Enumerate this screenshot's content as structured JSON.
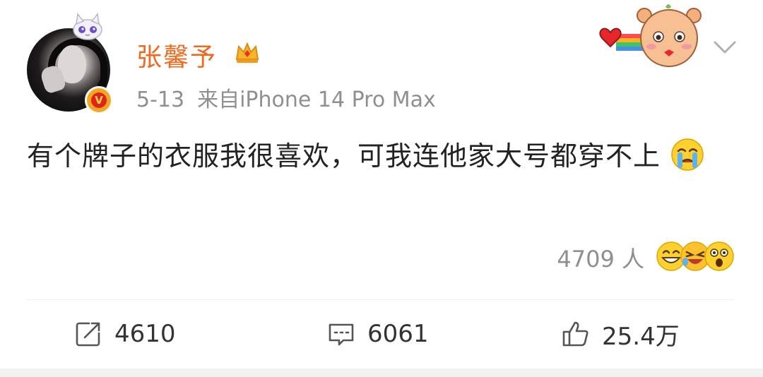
{
  "post": {
    "author": {
      "name": "张馨予"
    },
    "meta": {
      "date": "5-13",
      "source": "来自iPhone 14 Pro Max"
    },
    "content": {
      "text": "有个牌子的衣服我很喜欢，可我连他家大号都穿不上",
      "trailing_emoji": "crying-face-emoji"
    },
    "reactions": {
      "count_label": "4709 人",
      "emojis": [
        "grin-emoji",
        "laugh-tears-emoji",
        "surprised-emoji"
      ]
    },
    "actions": {
      "repost": {
        "icon": "repost-icon",
        "count": "4610"
      },
      "comment": {
        "icon": "comment-icon",
        "count": "6061"
      },
      "like": {
        "icon": "thumbs-up-icon",
        "count": "25.4万"
      }
    }
  },
  "colors": {
    "username": "#f0691c",
    "meta_text": "#8f8f8f",
    "body_text": "#222222",
    "action_text": "#333333",
    "verified_badge": "#e0221b"
  }
}
